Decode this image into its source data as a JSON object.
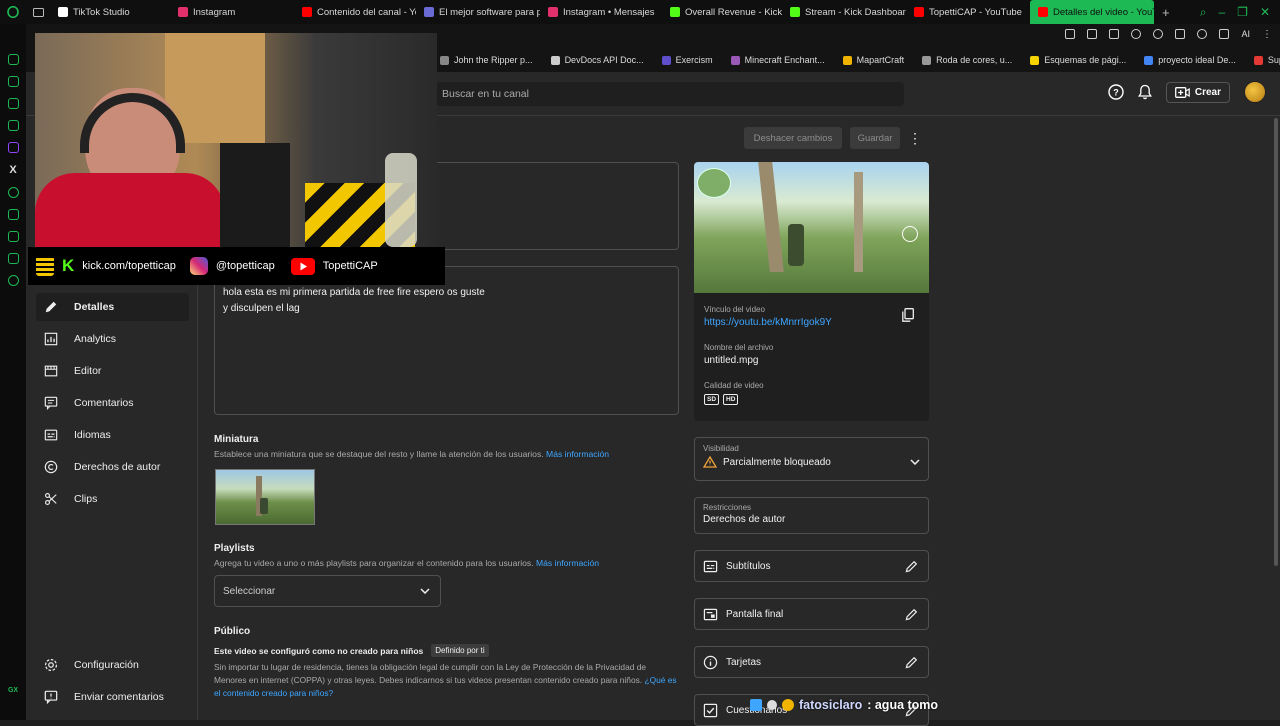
{
  "browser": {
    "tabs": [
      {
        "label": "TikTok Studio",
        "color": "#ffffff"
      },
      {
        "label": "Instagram",
        "color": "#e1306c"
      },
      {
        "label": "Contenido del canal - Yo",
        "color": "#ff0000"
      },
      {
        "label": "El mejor software para p",
        "color": "#6b6bd6"
      },
      {
        "label": "Instagram • Mensajes",
        "color": "#e1306c"
      },
      {
        "label": "Overall Revenue - Kick D",
        "color": "#53fc18"
      },
      {
        "label": "Stream - Kick Dashboard",
        "color": "#53fc18"
      },
      {
        "label": "TopettiCAP - YouTube",
        "color": "#ff0000"
      },
      {
        "label": "Detalles del video - YouTu",
        "color": "#ff0000",
        "active": true
      }
    ],
    "new_tab": "+",
    "bookmarks": [
      {
        "label": "John the Ripper p...",
        "color": "#888888"
      },
      {
        "label": "DevDocs API Doc...",
        "color": "#cccccc"
      },
      {
        "label": "Exercism",
        "color": "#604fcd"
      },
      {
        "label": "Minecraft Enchant...",
        "color": "#9b59b6"
      },
      {
        "label": "MapartCraft",
        "color": "#f0b400"
      },
      {
        "label": "Roda de cores, u...",
        "color": "#999999"
      },
      {
        "label": "Esquemas de pági...",
        "color": "#f5d400"
      },
      {
        "label": "proyecto ideal De...",
        "color": "#4285f4"
      },
      {
        "label": "Supermatch",
        "color": "#e53935"
      }
    ],
    "ai_label": "AI",
    "accent": "#1db954"
  },
  "header": {
    "search_placeholder": "Buscar en tu canal",
    "create_label": "Crear"
  },
  "sidebar": {
    "items": [
      {
        "label": "Detalles",
        "icon": "pencil-icon",
        "active": true
      },
      {
        "label": "Analytics",
        "icon": "analytics-icon"
      },
      {
        "label": "Editor",
        "icon": "editor-icon"
      },
      {
        "label": "Comentarios",
        "icon": "comments-icon"
      },
      {
        "label": "Idiomas",
        "icon": "subtitles-icon"
      },
      {
        "label": "Derechos de autor",
        "icon": "copyright-icon"
      },
      {
        "label": "Clips",
        "icon": "scissors-icon"
      }
    ],
    "settings_label": "Configuración",
    "feedback_label": "Enviar comentarios"
  },
  "toolbar": {
    "undo_label": "Deshacer cambios",
    "save_label": "Guardar"
  },
  "details": {
    "description": "hola esta es mi primera partida de free fire espero os guste\ny disculpen el lag",
    "thumbnail_title": "Miniatura",
    "thumbnail_sub": "Establece una miniatura que se destaque del resto y llame la atención de los usuarios.",
    "thumbnail_link": "Más información",
    "playlists_title": "Playlists",
    "playlists_sub": "Agrega tu video a uno o más playlists para organizar el contenido para los usuarios.",
    "playlists_link": "Más información",
    "playlist_select": "Seleccionar",
    "audience_title": "Público",
    "audience_status": "Este video se configuró como no creado para niños",
    "audience_badge": "Definido por ti",
    "audience_text": "Sin importar tu lugar de residencia, tienes la obligación legal de cumplir con la Ley de Protección de la Privacidad de Menores en internet (COPPA) y otras leyes. Debes indicarnos si tus videos presentan contenido creado para niños.",
    "audience_link": "¿Qué es el contenido creado para niños?"
  },
  "video_info": {
    "link_label": "Vínculo del video",
    "link_url": "https://youtu.be/kMnrrIgok9Y",
    "filename_label": "Nombre del archivo",
    "filename": "untitled.mpg",
    "quality_label": "Calidad de video",
    "quality_badges": [
      "SD",
      "HD"
    ]
  },
  "visibility": {
    "label": "Visibilidad",
    "value": "Parcialmente bloqueado"
  },
  "restrictions": {
    "label": "Restricciones",
    "value": "Derechos de autor"
  },
  "extras": [
    {
      "label": "Subtítulos",
      "icon": "subtitles-icon"
    },
    {
      "label": "Pantalla final",
      "icon": "end-screen-icon"
    },
    {
      "label": "Tarjetas",
      "icon": "info-card-icon"
    },
    {
      "label": "Cuestionarios",
      "icon": "checkbox-icon"
    }
  ],
  "stream_overlay": {
    "kick": "kick.com/topetticap",
    "instagram": "@topetticap",
    "youtube": "TopettiCAP",
    "chat_user": "fatosiclaro",
    "chat_message": ": agua tomo"
  }
}
